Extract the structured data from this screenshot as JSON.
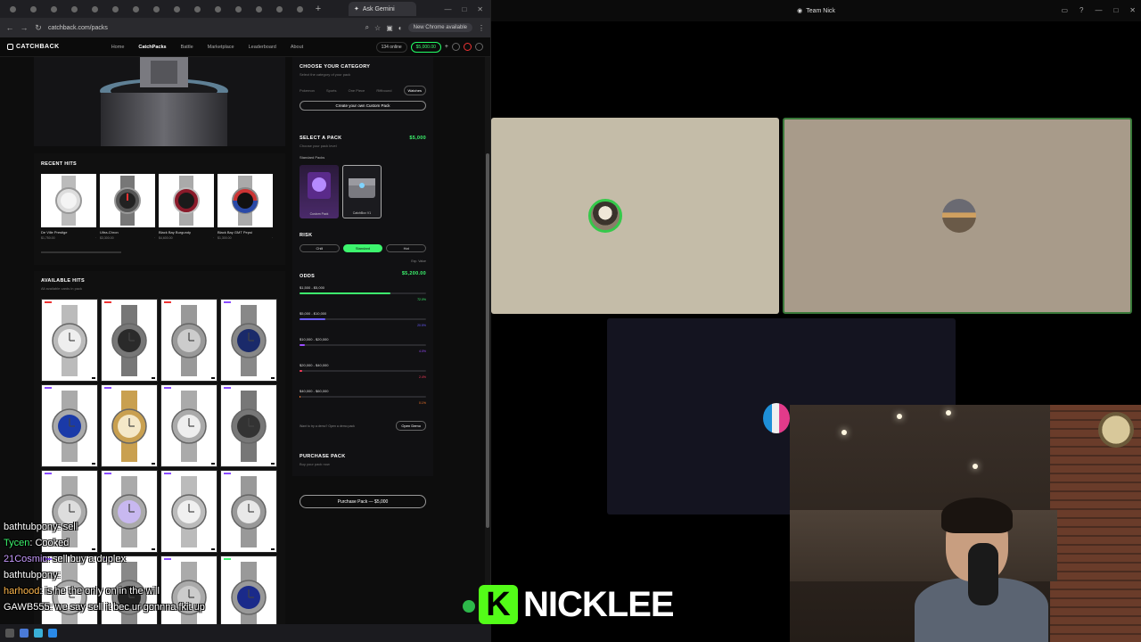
{
  "browser": {
    "active_tab": "Ask Gemini",
    "url": "catchback.com/packs",
    "chrome_note": "New Chrome available"
  },
  "site": {
    "logo": "CATCHBACK",
    "nav": [
      "Home",
      "CatchPacks",
      "Battle",
      "Marketplace",
      "Leaderboard",
      "About"
    ],
    "online": "134 online",
    "balance": "$5,000.00"
  },
  "recent_hits": {
    "title": "RECENT HITS",
    "items": [
      {
        "name": "De Ville Prestige",
        "price": "$1,750.00"
      },
      {
        "name": "Ultra-Chron",
        "price": "$3,300.00"
      },
      {
        "name": "Black Bay Burgundy",
        "price": "$4,600.00"
      },
      {
        "name": "Black Bay GMT Pepsi",
        "price": "$1,300.00"
      }
    ]
  },
  "available_hits": {
    "title": "AVAILABLE HITS",
    "subtitle": "All available cards in pack"
  },
  "category": {
    "title": "CHOOSE YOUR CATEGORY",
    "subtitle": "Select the category of your pack",
    "tabs": [
      "Pokemon",
      "Sports",
      "One Piece",
      "Riftbound",
      "Watches"
    ],
    "create_btn": "Create your own Custom Pack"
  },
  "select_pack": {
    "title": "SELECT A PACK",
    "price": "$5,000",
    "subtitle": "Choose your pack level",
    "group": "Standard Packs",
    "packs": [
      "Custom Pack",
      "CatchBox V1"
    ]
  },
  "risk": {
    "title": "RISK",
    "options": [
      "Chill",
      "Standard",
      "Hot"
    ]
  },
  "odds": {
    "title": "ODDS",
    "exp_label": "Exp. Value",
    "exp_value": "$5,200.00",
    "rows": [
      {
        "range": "$1,500 - $5,000",
        "pct": "72.0%",
        "level": 72,
        "color": "#3df56e"
      },
      {
        "range": "$5,000 - $10,000",
        "pct": "20.5%",
        "level": 20.5,
        "color": "#6a5cff"
      },
      {
        "range": "$10,000 - $20,000",
        "pct": "4.0%",
        "level": 4,
        "color": "#9b4cff"
      },
      {
        "range": "$20,000 - $40,000",
        "pct": "2.4%",
        "level": 2.4,
        "color": "#ff3b5c"
      },
      {
        "range": "$40,000 - $60,000",
        "pct": "0.1%",
        "level": 0.1,
        "color": "#ff7a2b"
      }
    ]
  },
  "demo": {
    "text": "Want to try a demo? Open a demo pack",
    "btn": "Open Demo"
  },
  "purchase": {
    "title": "PURCHASE PACK",
    "subtitle": "Buy your pack now",
    "btn": "Purchase Pack — $5,000"
  },
  "chat": [
    {
      "user": "bathtubpony",
      "msg": "sell",
      "color": "#ffffff"
    },
    {
      "user": "Tycen",
      "msg": "Cooked",
      "color": "#3df56e"
    },
    {
      "user": "21Cosmic",
      "msg": "sell buy a duplex",
      "color": "#c89bff"
    },
    {
      "user": "bathtubpony",
      "msg": "",
      "color": "#ffffff"
    },
    {
      "user": "harhood",
      "msg": "is he the only on in the will",
      "color": "#ffb84d"
    },
    {
      "user": "GAWB555",
      "msg": "we say sell it bec ur gonnna fkit up",
      "color": "#ffffff"
    }
  ],
  "meeting": {
    "title": "Team Nick"
  },
  "streamer": {
    "name": "NICKLEE",
    "k": "K"
  }
}
